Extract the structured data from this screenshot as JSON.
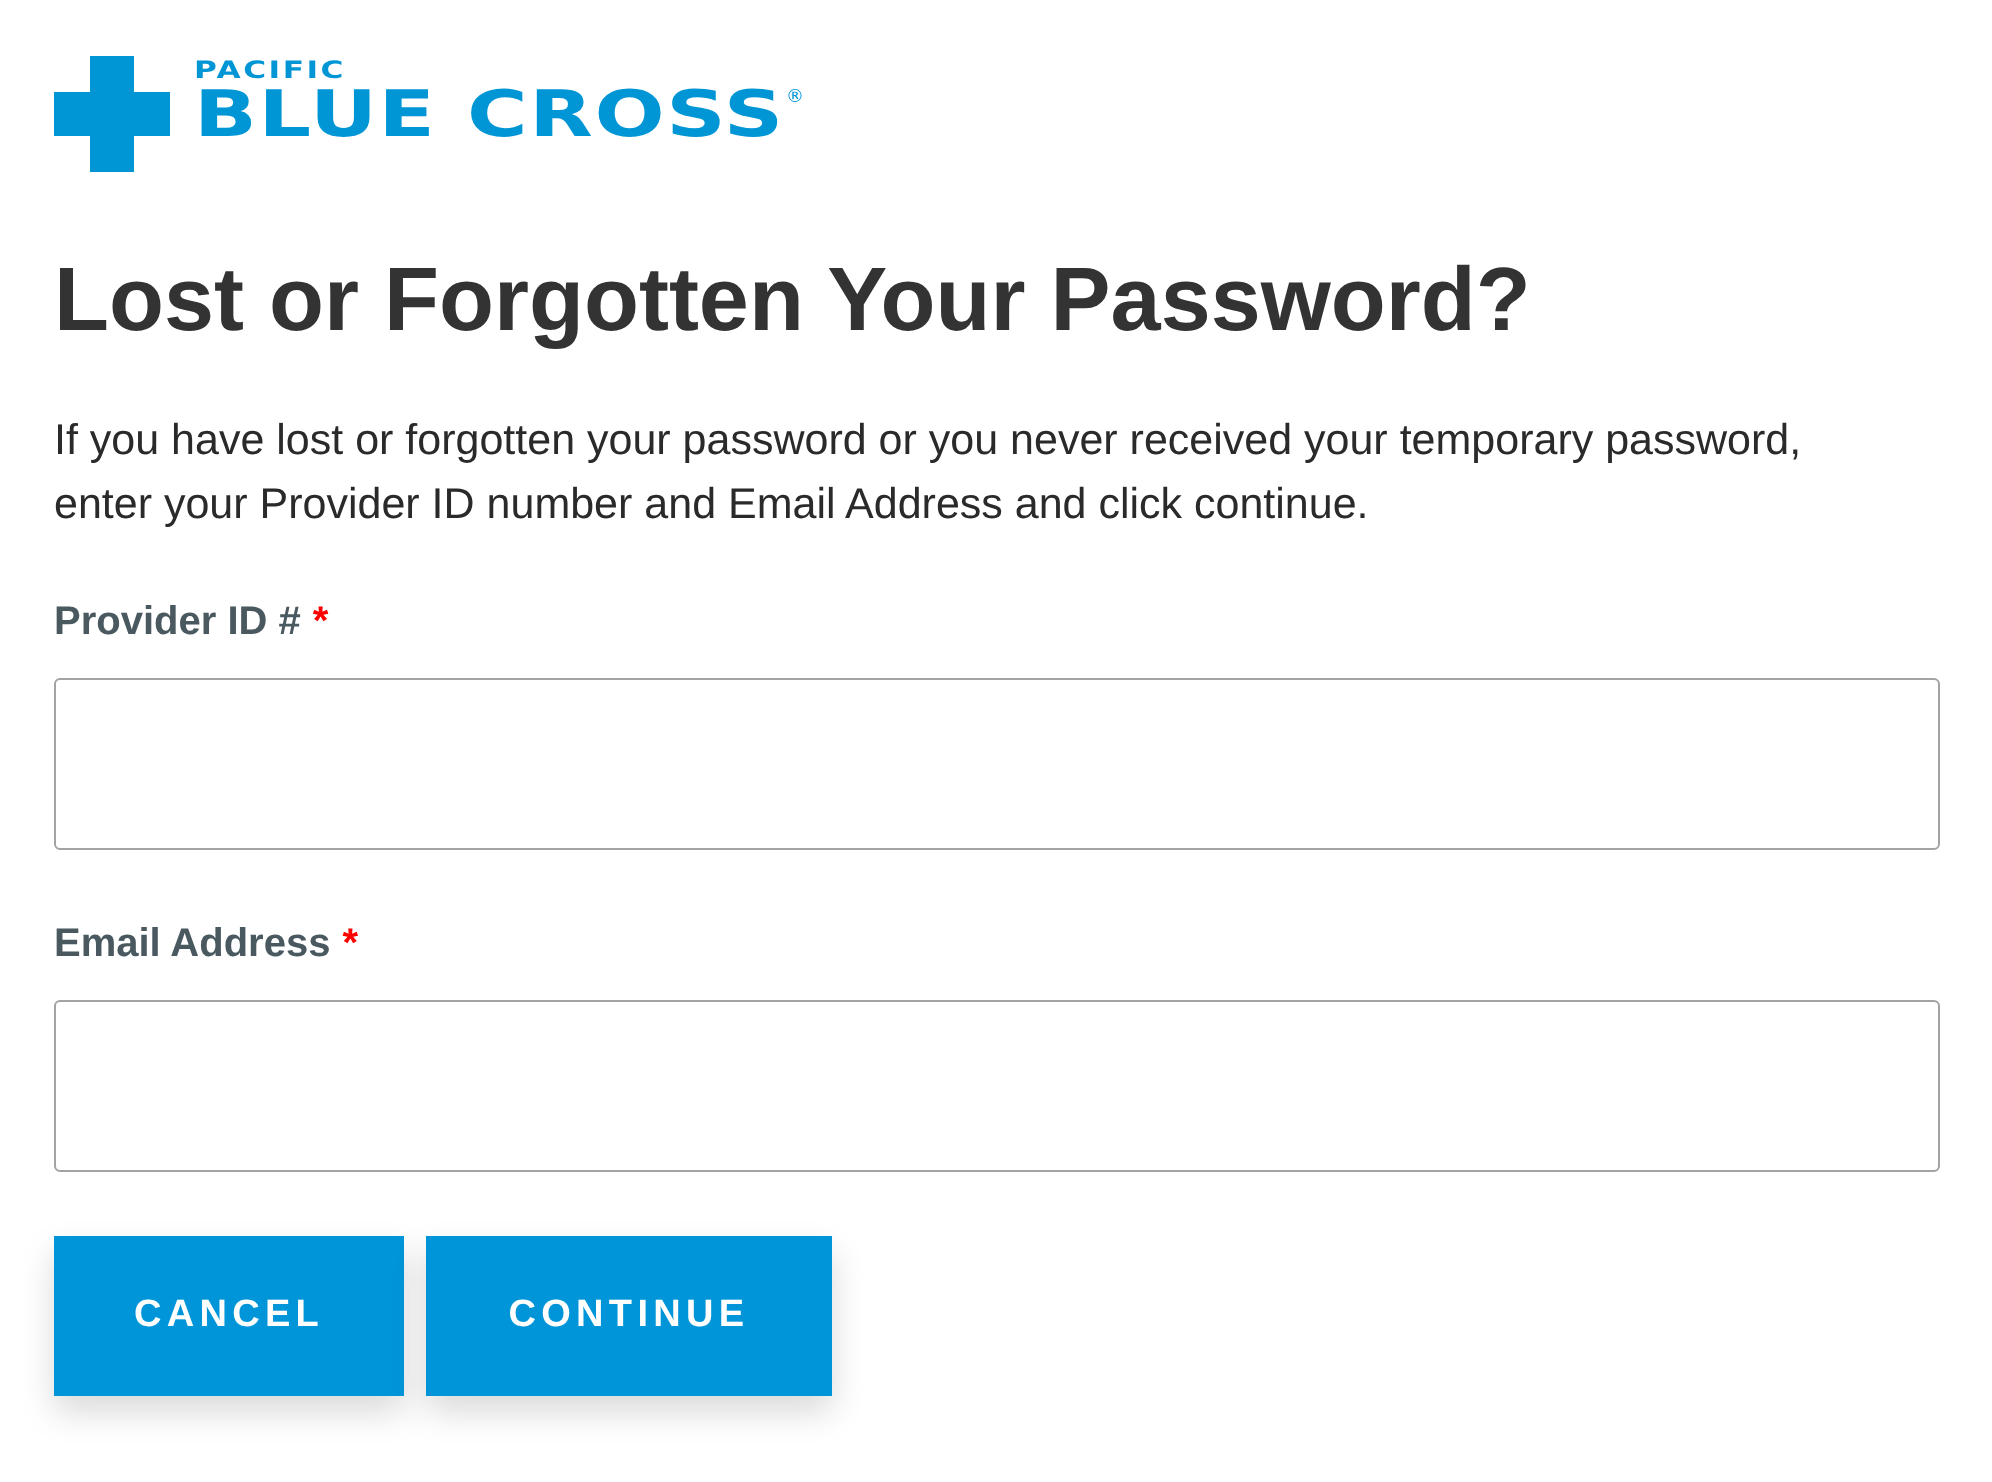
{
  "logo": {
    "overline": "PACIFIC",
    "name": "BLUE CROSS",
    "mark": "®"
  },
  "heading": "Lost or Forgotten Your Password?",
  "intro": "If you have lost or forgotten your password or you never received your temporary password, enter your Provider ID number and Email Address and click continue.",
  "fields": [
    {
      "label": "Provider ID #",
      "required_mark": "*"
    },
    {
      "label": "Email Address",
      "required_mark": "*"
    }
  ],
  "buttons": [
    {
      "label": "CANCEL"
    },
    {
      "label": "CONTINUE"
    }
  ]
}
